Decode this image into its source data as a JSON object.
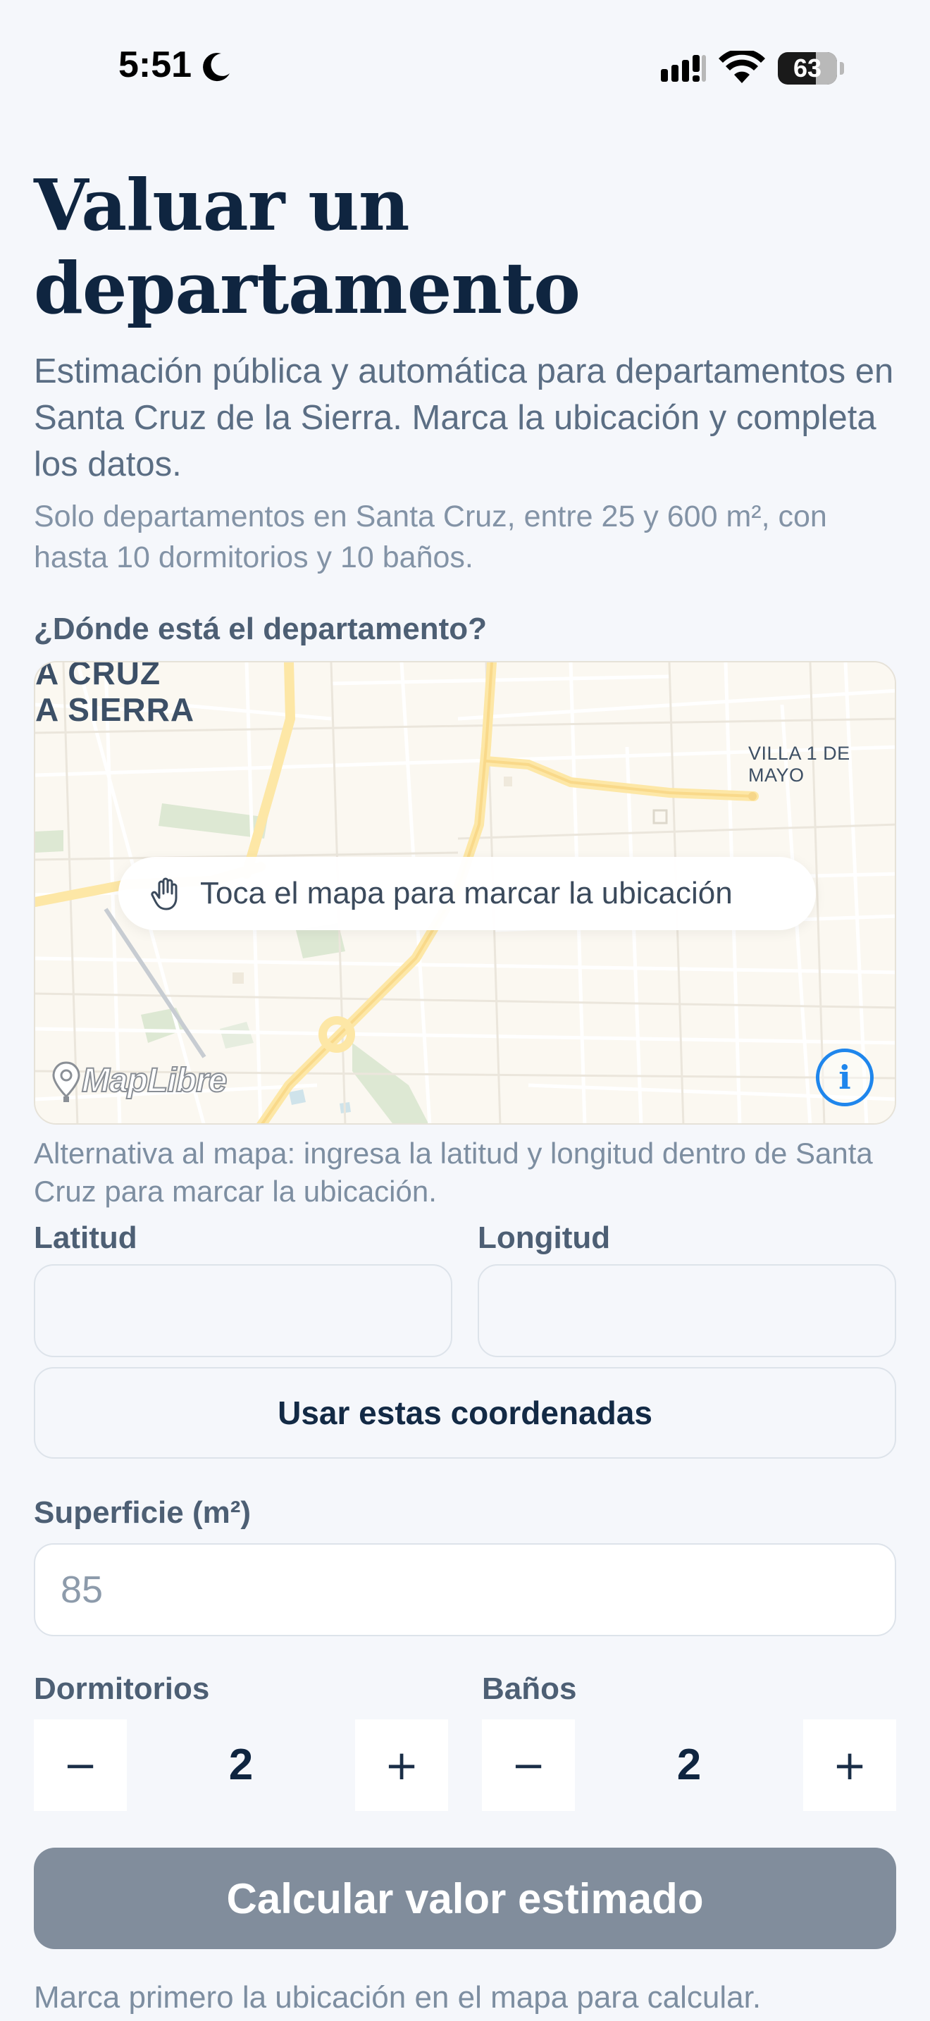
{
  "status_bar": {
    "time": "5:51",
    "battery": "63"
  },
  "header": {
    "title": "Valuar un departamento",
    "intro": "Estimación pública y automática para departamentos en Santa Cruz de la Sierra. Marca la ubicación y completa los datos.",
    "note": "Solo departamentos en Santa Cruz, entre 25 y 600 m², con hasta 10 dormitorios y 10 baños."
  },
  "map_section": {
    "label": "¿Dónde está el departamento?",
    "city_label_line1": "A CRUZ",
    "city_label_line2": "A SIERRA",
    "district_label": "VILLA 1 DE MAYO",
    "hint": "Toca el mapa para marcar la ubicación",
    "attribution": "MapLibre"
  },
  "coordinates": {
    "alt_text": "Alternativa al mapa: ingresa la latitud y longitud dentro de Santa Cruz para marcar la ubicación.",
    "lat_label": "Latitud",
    "lat_value": "",
    "lng_label": "Longitud",
    "lng_value": "",
    "use_button": "Usar estas coordenadas"
  },
  "surface": {
    "label": "Superficie (m²)",
    "placeholder": "85"
  },
  "bedrooms": {
    "label": "Dormitorios",
    "value": "2",
    "minus": "−",
    "plus": "+"
  },
  "bathrooms": {
    "label": "Baños",
    "value": "2",
    "minus": "−",
    "plus": "+"
  },
  "actions": {
    "calculate": "Calcular valor estimado",
    "footer_hint": "Marca primero la ubicación en el mapa para calcular."
  },
  "colors": {
    "primary_text": "#0f2540",
    "accent_blue": "#1f86ec",
    "disabled_button": "#818d9c",
    "background": "#f5f7fb"
  }
}
